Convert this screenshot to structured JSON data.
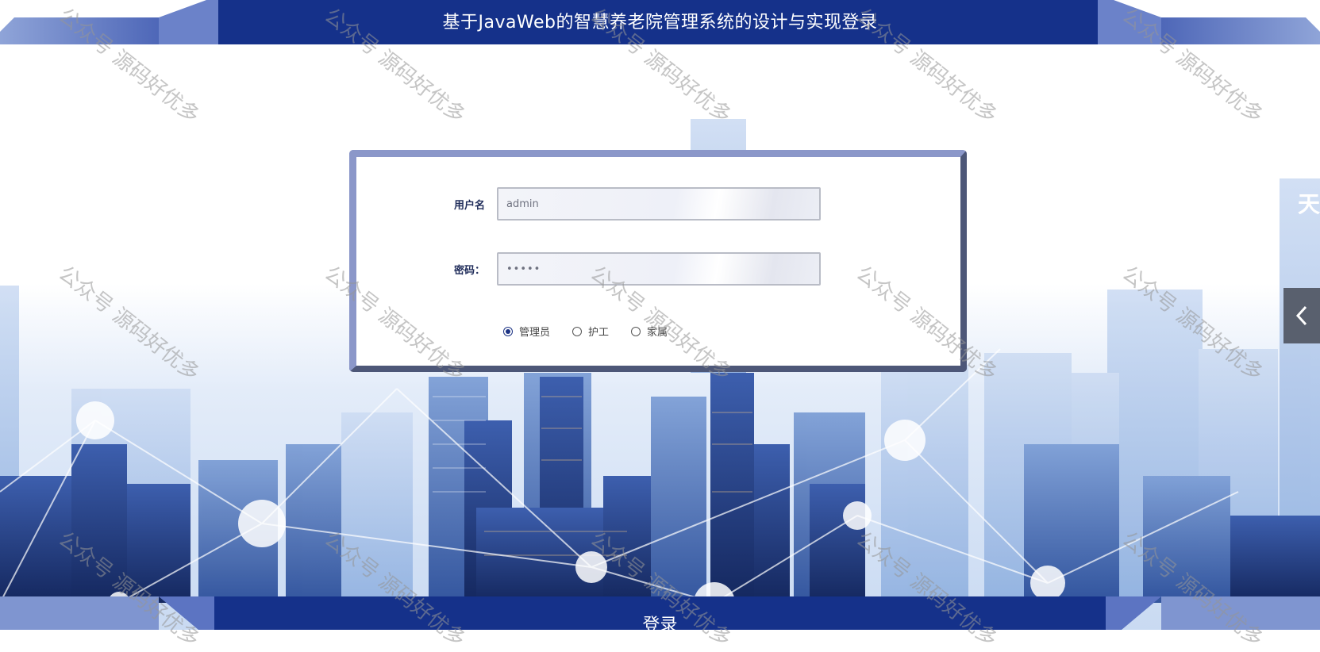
{
  "header": {
    "title": "基于JavaWeb的智慧养老院管理系统的设计与实现登录"
  },
  "form": {
    "username_label": "用户名",
    "username_value": "admin",
    "password_label": "密码：",
    "password_value": "•••••",
    "roles": [
      {
        "label": "管理员",
        "checked": true
      },
      {
        "label": "护工",
        "checked": false
      },
      {
        "label": "家属",
        "checked": false
      }
    ]
  },
  "footer": {
    "login_label": "登录"
  },
  "watermark": {
    "text": "公众号 源码好优多"
  },
  "background": {
    "corner_text": "天"
  },
  "colors": {
    "header_blue": "#15318a",
    "card_border_light": "#8b97c9",
    "card_border_dark": "#4d5778"
  }
}
